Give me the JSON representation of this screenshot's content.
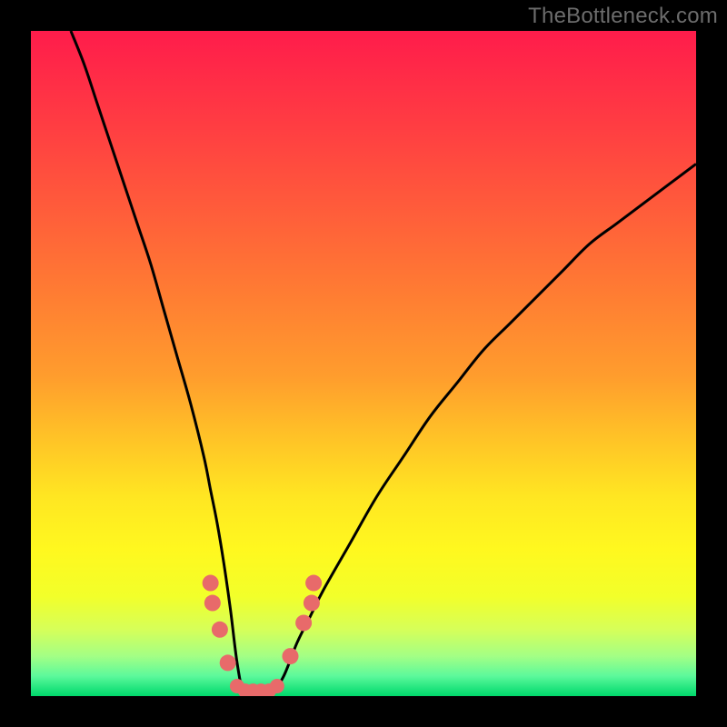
{
  "attribution": "TheBottleneck.com",
  "chart_data": {
    "type": "line",
    "title": "",
    "xlabel": "",
    "ylabel": "",
    "xlim": [
      0,
      100
    ],
    "ylim": [
      0,
      100
    ],
    "x": [
      6,
      8,
      10,
      12,
      14,
      16,
      18,
      20,
      22,
      24,
      26,
      27,
      28,
      29,
      30,
      31,
      32,
      33,
      34,
      35,
      36,
      38,
      40,
      42,
      44,
      48,
      52,
      56,
      60,
      64,
      68,
      72,
      76,
      80,
      84,
      88,
      92,
      96,
      100
    ],
    "y": [
      100,
      95,
      89,
      83,
      77,
      71,
      65,
      58,
      51,
      44,
      36,
      31,
      26,
      20,
      13,
      5,
      0,
      0,
      0,
      0,
      0,
      3,
      8,
      12,
      16,
      23,
      30,
      36,
      42,
      47,
      52,
      56,
      60,
      64,
      68,
      71,
      74,
      77,
      80
    ],
    "gradient_stops": [
      {
        "pct": 0,
        "color": "#ff1c4b"
      },
      {
        "pct": 13,
        "color": "#ff3a43"
      },
      {
        "pct": 26,
        "color": "#ff5a3b"
      },
      {
        "pct": 39,
        "color": "#ff7b33"
      },
      {
        "pct": 52,
        "color": "#ff9d2d"
      },
      {
        "pct": 61,
        "color": "#ffc227"
      },
      {
        "pct": 70,
        "color": "#ffe622"
      },
      {
        "pct": 78,
        "color": "#fff81f"
      },
      {
        "pct": 85,
        "color": "#f2ff2a"
      },
      {
        "pct": 90,
        "color": "#d6ff59"
      },
      {
        "pct": 94,
        "color": "#a3ff85"
      },
      {
        "pct": 97,
        "color": "#5cf99b"
      },
      {
        "pct": 99,
        "color": "#1de37b"
      },
      {
        "pct": 100,
        "color": "#00d86b"
      }
    ],
    "markers": [
      {
        "x": 27.0,
        "y": 17,
        "r": 9
      },
      {
        "x": 27.3,
        "y": 14,
        "r": 9
      },
      {
        "x": 28.4,
        "y": 10,
        "r": 9
      },
      {
        "x": 29.6,
        "y": 5,
        "r": 9
      },
      {
        "x": 31.0,
        "y": 1.5,
        "r": 8
      },
      {
        "x": 32.2,
        "y": 0.8,
        "r": 8
      },
      {
        "x": 33.4,
        "y": 0.8,
        "r": 8
      },
      {
        "x": 34.6,
        "y": 0.8,
        "r": 8
      },
      {
        "x": 35.8,
        "y": 0.8,
        "r": 8
      },
      {
        "x": 37.0,
        "y": 1.5,
        "r": 8
      },
      {
        "x": 39.0,
        "y": 6,
        "r": 9
      },
      {
        "x": 41.0,
        "y": 11,
        "r": 9
      },
      {
        "x": 42.2,
        "y": 14,
        "r": 9
      },
      {
        "x": 42.5,
        "y": 17,
        "r": 9
      }
    ],
    "marker_color": "#e86a6a",
    "curve_color": "#000000",
    "curve_width": 3
  }
}
